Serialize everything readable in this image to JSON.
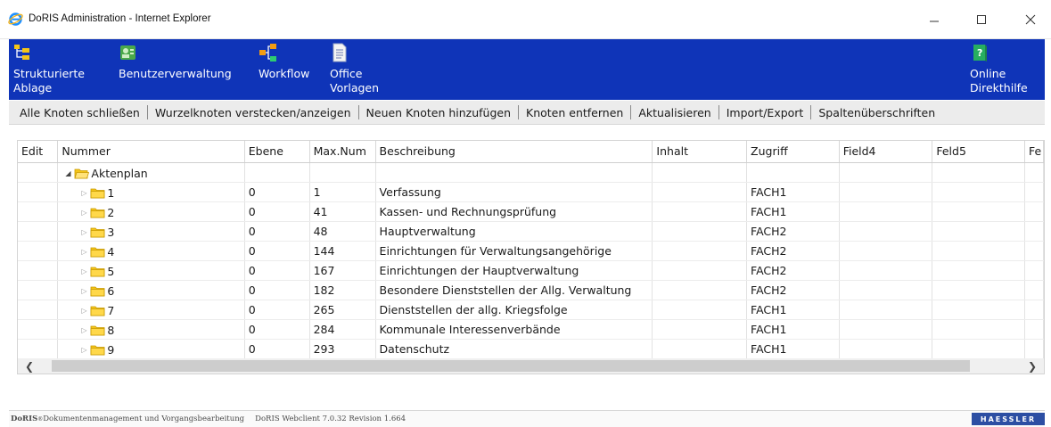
{
  "window": {
    "title": "DoRIS Administration - Internet Explorer",
    "controls": {
      "minimize": "minimize-icon",
      "maximize": "maximize-icon",
      "close": "close-icon"
    }
  },
  "toolbar": {
    "items": [
      {
        "label": "Strukturierte\nAblage",
        "icon": "structure-icon"
      },
      {
        "label": "Benutzerverwaltung",
        "icon": "users-icon"
      },
      {
        "label": "Workflow",
        "icon": "workflow-icon"
      },
      {
        "label": "Office\nVorlagen",
        "icon": "document-icon"
      }
    ],
    "help": {
      "label": "Online\nDirekthilfe",
      "icon": "help-book-icon"
    }
  },
  "actions": [
    "Alle Knoten schließen",
    "Wurzelknoten verstecken/anzeigen",
    "Neuen Knoten hinzufügen",
    "Knoten entfernen",
    "Aktualisieren",
    "Import/Export",
    "Spaltenüberschriften"
  ],
  "grid": {
    "columns": [
      "Edit",
      "Nummer",
      "Ebene",
      "Max.Num",
      "Beschreibung",
      "Inhalt",
      "Zugriff",
      "Field4",
      "Feld5",
      "Fe"
    ],
    "root": {
      "label": "Aktenplan"
    },
    "rows": [
      {
        "nummer": "1",
        "ebene": "0",
        "maxnum": "1",
        "beschreibung": "Verfassung",
        "zugriff": "FACH1"
      },
      {
        "nummer": "2",
        "ebene": "0",
        "maxnum": "41",
        "beschreibung": "Kassen- und Rechnungsprüfung",
        "zugriff": "FACH1"
      },
      {
        "nummer": "3",
        "ebene": "0",
        "maxnum": "48",
        "beschreibung": "Hauptverwaltung",
        "zugriff": "FACH2"
      },
      {
        "nummer": "4",
        "ebene": "0",
        "maxnum": "144",
        "beschreibung": "Einrichtungen für Verwaltungsangehörige",
        "zugriff": "FACH2"
      },
      {
        "nummer": "5",
        "ebene": "0",
        "maxnum": "167",
        "beschreibung": "Einrichtungen der Hauptverwaltung",
        "zugriff": "FACH2"
      },
      {
        "nummer": "6",
        "ebene": "0",
        "maxnum": "182",
        "beschreibung": "Besondere Dienststellen der Allg. Verwaltung",
        "zugriff": "FACH2"
      },
      {
        "nummer": "7",
        "ebene": "0",
        "maxnum": "265",
        "beschreibung": "Dienststellen der allg. Kriegsfolge",
        "zugriff": "FACH1"
      },
      {
        "nummer": "8",
        "ebene": "0",
        "maxnum": "284",
        "beschreibung": "Kommunale Interessenverbände",
        "zugriff": "FACH1"
      },
      {
        "nummer": "9",
        "ebene": "0",
        "maxnum": "293",
        "beschreibung": "Datenschutz",
        "zugriff": "FACH1"
      }
    ]
  },
  "scrollbar": {
    "left_arrow": "chevron-left-icon",
    "right_arrow": "chevron-right-icon"
  },
  "footer": {
    "brand": "DoRIS",
    "registered": "®",
    "tagline": " Dokumentenmanagement und Vorgangsbearbeitung",
    "version": "DoRIS Webclient 7.0.32 Revision 1.664",
    "logo": "HAESSLER"
  },
  "colors": {
    "toolbar_bg": "#0f34b8",
    "actionbar_bg": "#ececec",
    "folder": "#f5c518",
    "logo_bg": "#2c4ea3"
  }
}
